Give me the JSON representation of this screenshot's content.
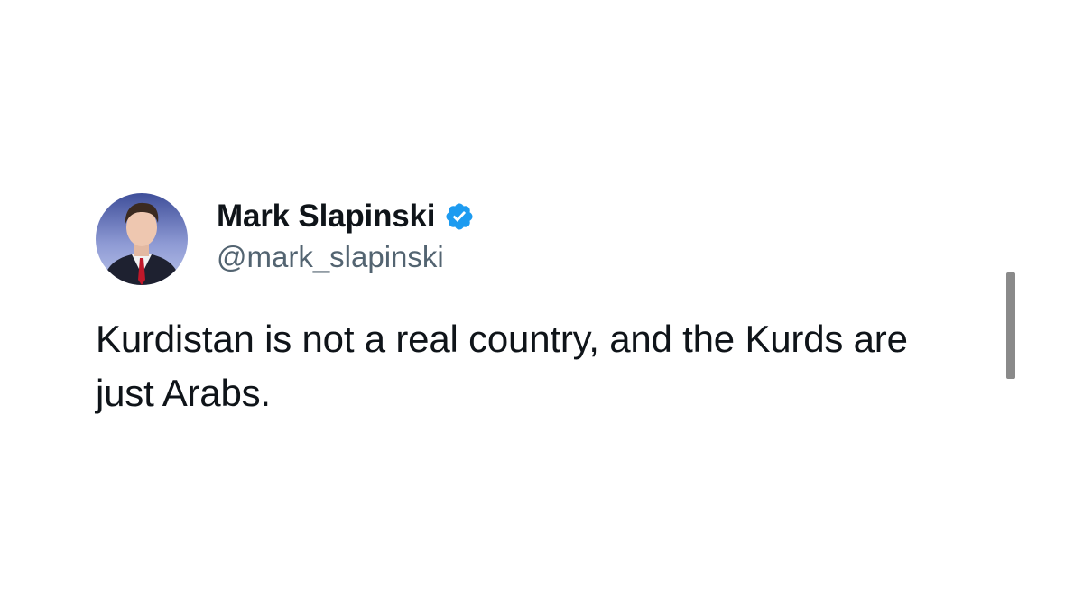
{
  "tweet": {
    "author": {
      "display_name": "Mark Slapinski",
      "handle": "@mark_slapinski",
      "verified_icon": "verified-badge-icon",
      "avatar_icon": "profile-photo"
    },
    "text": "Kurdistan is not a real country, and the Kurds are just Arabs."
  },
  "colors": {
    "text_primary": "#0f1419",
    "text_secondary": "#536471",
    "verified_blue": "#1d9bf0",
    "scrollbar": "#8a8a8a"
  }
}
